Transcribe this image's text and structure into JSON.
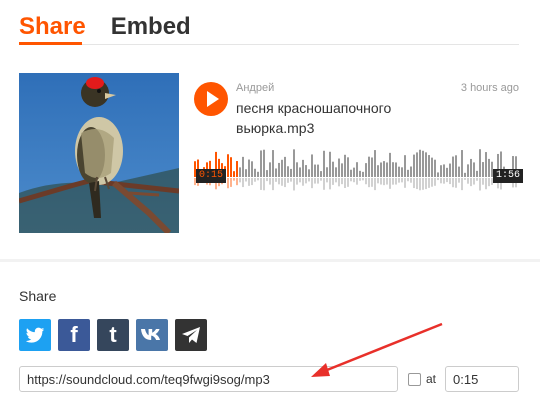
{
  "tabs": [
    {
      "label": "Share",
      "active": true
    },
    {
      "label": "Embed",
      "active": false
    }
  ],
  "track": {
    "uploader": "Андрей",
    "time_ago": "3 hours ago",
    "title": "песня красношапочного вьюрка.mp3",
    "current_time": "0:15",
    "duration": "1:56",
    "progress": 0.13
  },
  "share": {
    "label": "Share",
    "networks": [
      {
        "name": "twitter",
        "glyph": ""
      },
      {
        "name": "facebook",
        "glyph": "f"
      },
      {
        "name": "tumblr",
        "glyph": "t"
      },
      {
        "name": "vk",
        "glyph": ""
      },
      {
        "name": "telegram",
        "glyph": ""
      }
    ],
    "url": "https://soundcloud.com/teq9fwgi9sog/mp3",
    "at_label": "at",
    "at_checked": false,
    "at_time": "0:15"
  },
  "colors": {
    "accent": "#ff5500",
    "arrow": "#e8302a"
  }
}
